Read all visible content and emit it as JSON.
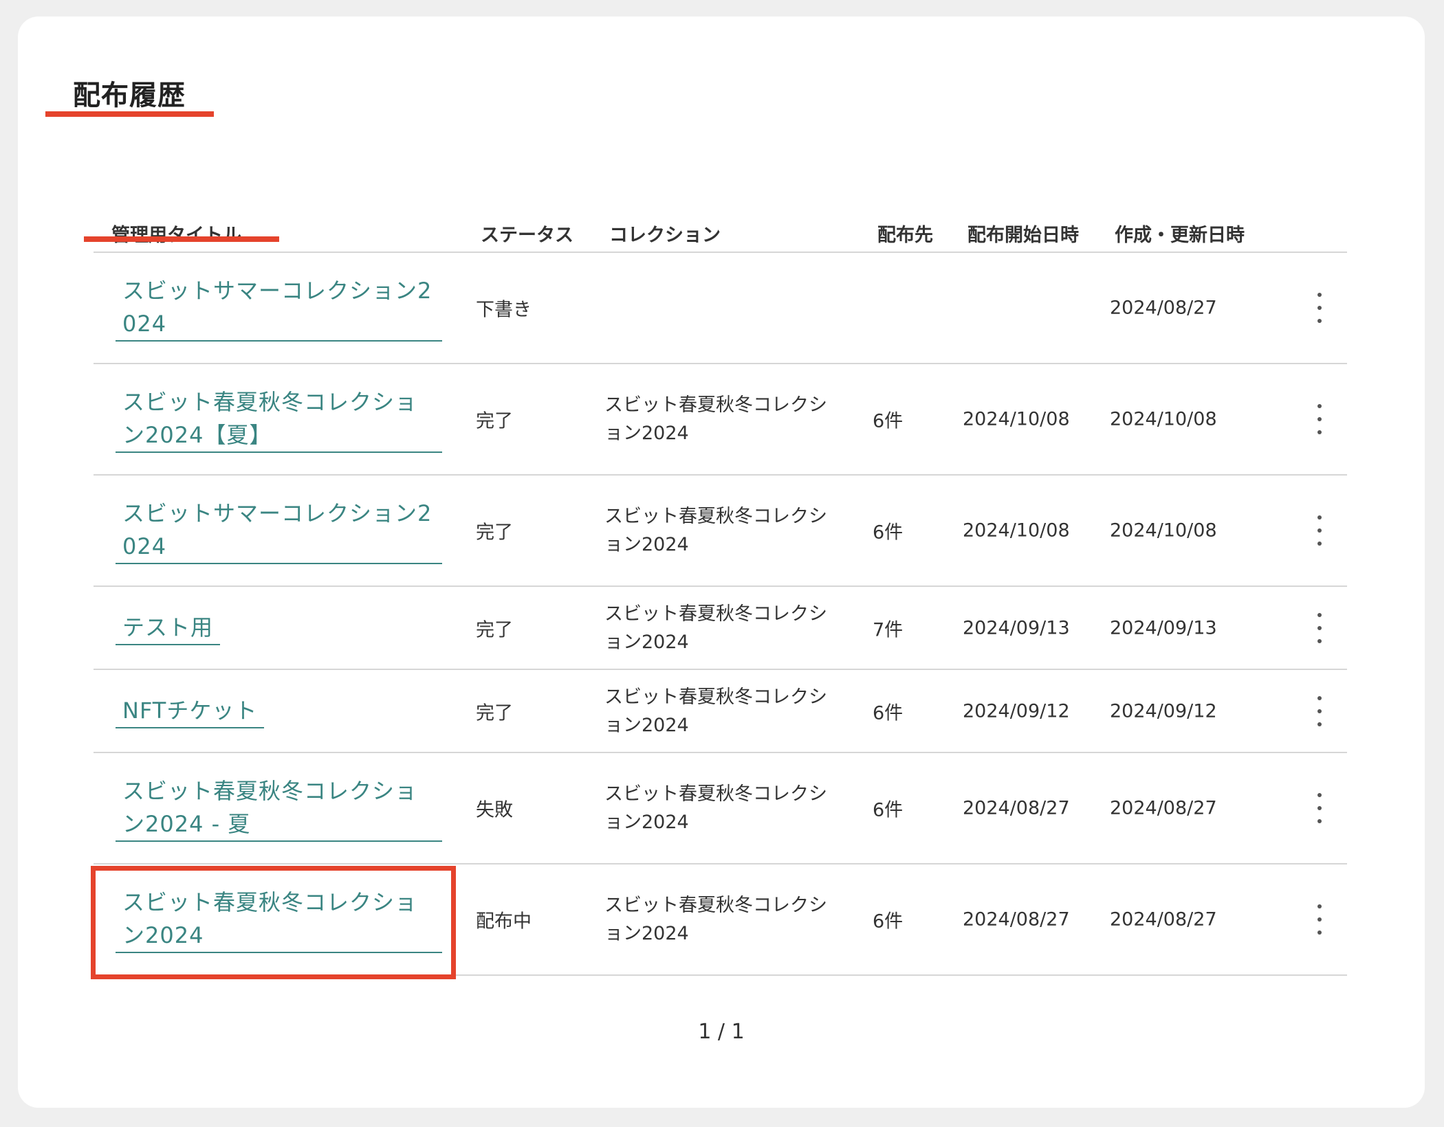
{
  "page": {
    "title": "配布履歴",
    "accent_color": "#e5432c",
    "link_color": "#3a8582"
  },
  "table": {
    "headers": {
      "title": "管理用タイトル",
      "status": "ステータス",
      "collection": "コレクション",
      "destination": "配布先",
      "start_date": "配布開始日時",
      "updated": "作成・更新日時"
    },
    "sorted_column": "管理用タイトル",
    "rows": [
      {
        "title": "スビットサマーコレクション2024",
        "status": "下書き",
        "collection": "",
        "destination": "",
        "start_date": "",
        "updated": "2024/08/27"
      },
      {
        "title": "スビット春夏秋冬コレクション2024【夏】",
        "status": "完了",
        "collection": "スビット春夏秋冬コレクション2024",
        "destination": "6件",
        "start_date": "2024/10/08",
        "updated": "2024/10/08"
      },
      {
        "title": "スビットサマーコレクション2024",
        "status": "完了",
        "collection": "スビット春夏秋冬コレクション2024",
        "destination": "6件",
        "start_date": "2024/10/08",
        "updated": "2024/10/08"
      },
      {
        "title": "テスト用",
        "status": "完了",
        "collection": "スビット春夏秋冬コレクション2024",
        "destination": "7件",
        "start_date": "2024/09/13",
        "updated": "2024/09/13"
      },
      {
        "title": "NFTチケット",
        "status": "完了",
        "collection": "スビット春夏秋冬コレクション2024",
        "destination": "6件",
        "start_date": "2024/09/12",
        "updated": "2024/09/12"
      },
      {
        "title": "スビット春夏秋冬コレクション2024 - 夏",
        "status": "失敗",
        "collection": "スビット春夏秋冬コレクション2024",
        "destination": "6件",
        "start_date": "2024/08/27",
        "updated": "2024/08/27"
      },
      {
        "title": "スビット春夏秋冬コレクション2024",
        "status": "配布中",
        "collection": "スビット春夏秋冬コレクション2024",
        "destination": "6件",
        "start_date": "2024/08/27",
        "updated": "2024/08/27",
        "highlighted": true
      }
    ]
  },
  "pagination": {
    "label": "1 / 1"
  },
  "icons": {
    "row_menu": "more-vertical-icon"
  }
}
